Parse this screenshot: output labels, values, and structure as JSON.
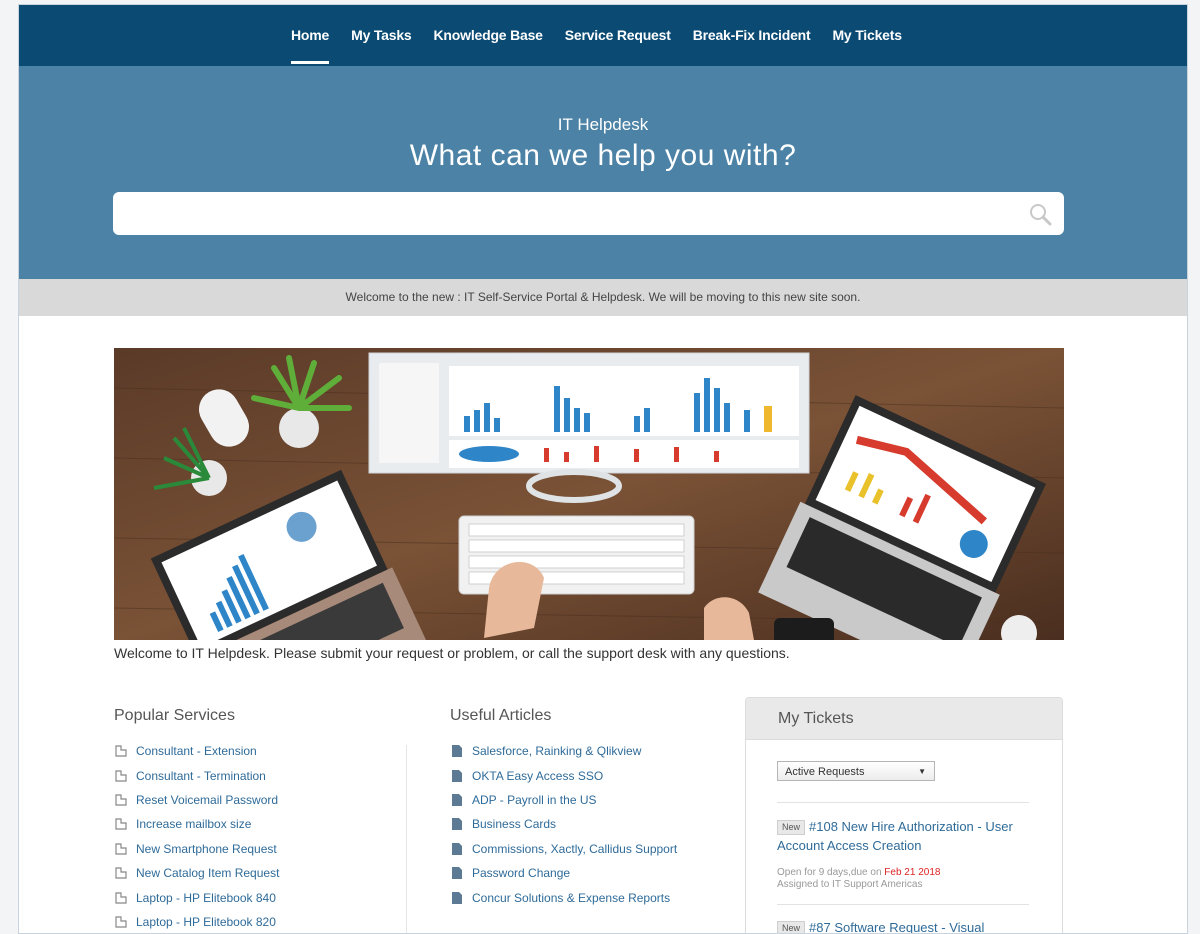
{
  "nav": {
    "items": [
      {
        "label": "Home",
        "active": true
      },
      {
        "label": "My Tasks"
      },
      {
        "label": "Knowledge Base"
      },
      {
        "label": "Service Request"
      },
      {
        "label": "Break-Fix Incident"
      },
      {
        "label": "My Tickets"
      }
    ]
  },
  "hero": {
    "subtitle": "IT Helpdesk",
    "title": "What can we help you with?",
    "search_value": "",
    "search_icon": "search-icon"
  },
  "announcement": "Welcome to the new : IT Self-Service Portal & Helpdesk. We will be moving to this new site soon.",
  "welcome_text": "Welcome to  IT Helpdesk. Please submit your request or problem, or call the support desk with any questions.",
  "popular_services": {
    "title": "Popular Services",
    "items": [
      "Consultant - Extension",
      "Consultant - Termination",
      "Reset Voicemail Password",
      "Increase mailbox size",
      "New Smartphone Request",
      "New Catalog Item Request",
      "Laptop - HP Elitebook 840",
      "Laptop - HP Elitebook 820"
    ]
  },
  "useful_articles": {
    "title": "Useful Articles",
    "items": [
      "Salesforce, Rainking & Qlikview",
      "OKTA Easy Access SSO",
      "ADP - Payroll in the US",
      "Business Cards",
      "Commissions, Xactly, Callidus Support",
      "Password Change",
      "Concur Solutions & Expense Reports"
    ]
  },
  "my_tickets": {
    "title": "My Tickets",
    "filter": "Active Requests",
    "tickets": [
      {
        "badge": "New",
        "title": "#108 New Hire Authorization - User Account Access Creation",
        "meta_prefix": "Open for 9 days,due on ",
        "due": "Feb 21 2018",
        "assigned": "Assigned to IT Support Americas"
      },
      {
        "badge": "New",
        "title": "#87 Software Request - Visual",
        "meta_prefix": "",
        "due": "",
        "assigned": ""
      }
    ]
  },
  "colors": {
    "nav_bg": "#0a4a73",
    "hero_bg": "#4b82a5",
    "link": "#2f6b99",
    "due": "#dd2222"
  }
}
